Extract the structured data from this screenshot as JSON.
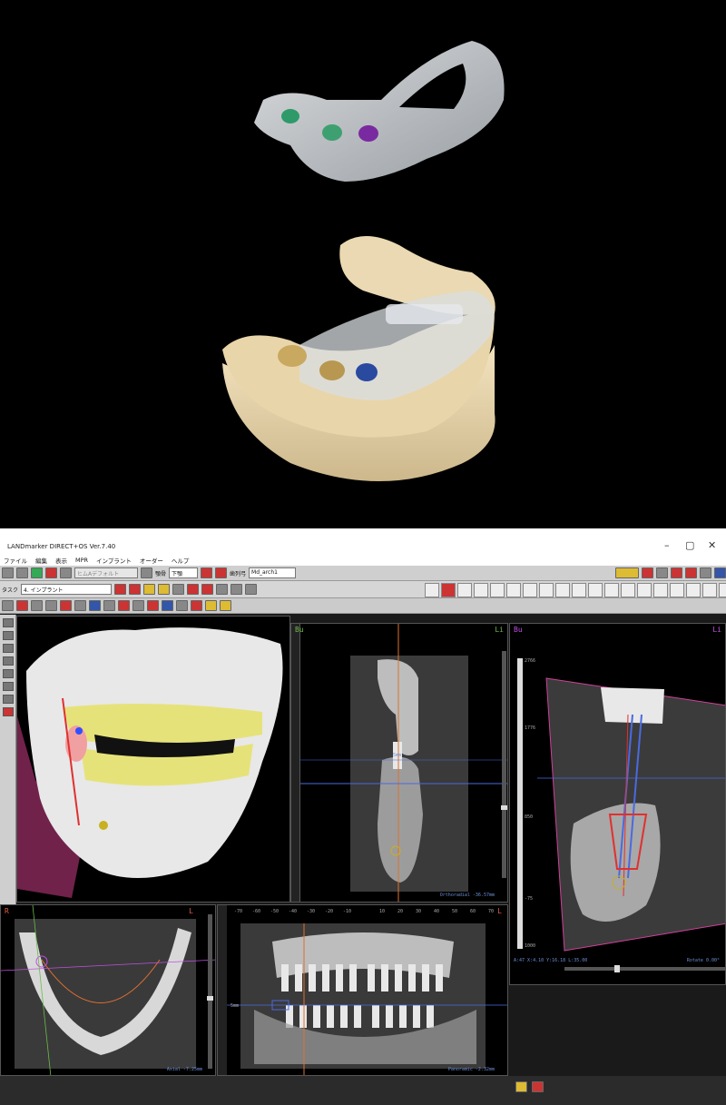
{
  "window": {
    "title": "LANDmarker DIRECT+OS Ver.7.40"
  },
  "menu": [
    "ファイル",
    "編集",
    "表示",
    "MPR",
    "インプラント",
    "オーダー",
    "ヘルプ"
  ],
  "toolbar1": {
    "disabled_field": "ヒムAデフォルト",
    "jaw_label": "顎骨",
    "jaw_value": "下顎",
    "arch_label": "歯列弓",
    "arch_value": "Md_arch1"
  },
  "toolbar2": {
    "task_label": "タスク",
    "task_value": "4. インプラント"
  },
  "thumbs": [
    "",
    "",
    "",
    "",
    "",
    "",
    "",
    "",
    "",
    "",
    "",
    "",
    "",
    "",
    "",
    "",
    "",
    "",
    "",
    ""
  ],
  "views": {
    "ortho": {
      "left_label": "Bu",
      "right_label": "Li",
      "info": "Orthoradial -36.57mm",
      "scale_label": "5mm"
    },
    "oblique": {
      "left_label": "Bu",
      "right_label": "Li",
      "scale_top": "2766",
      "scale_a": "1776",
      "scale_b": "850",
      "scale_c": "-75",
      "scale_bottom": "1000",
      "coords": "A:47 X:4.10 Y:16.18 L:35.00",
      "rotate": "Rotate 0.00°"
    },
    "axial": {
      "left_label": "R",
      "right_label": "L",
      "info": "Axial -7.25mm"
    },
    "pano": {
      "left_label": "R",
      "right_label": "L",
      "info": "Panoramic -2.32mm",
      "ticks": [
        "-70",
        "-60",
        "-50",
        "-40",
        "-30",
        "-20",
        "-10",
        "5mm",
        "10",
        "20",
        "30",
        "40",
        "50",
        "60",
        "70"
      ]
    }
  },
  "colors": {
    "ortho_label": "#6dbb4a",
    "oblique_label": "#c050e0",
    "axial_label": "#e06040",
    "guide_magenta": "#d0409a",
    "axis_blue": "#4a6adf",
    "implant_red": "#e03030"
  }
}
